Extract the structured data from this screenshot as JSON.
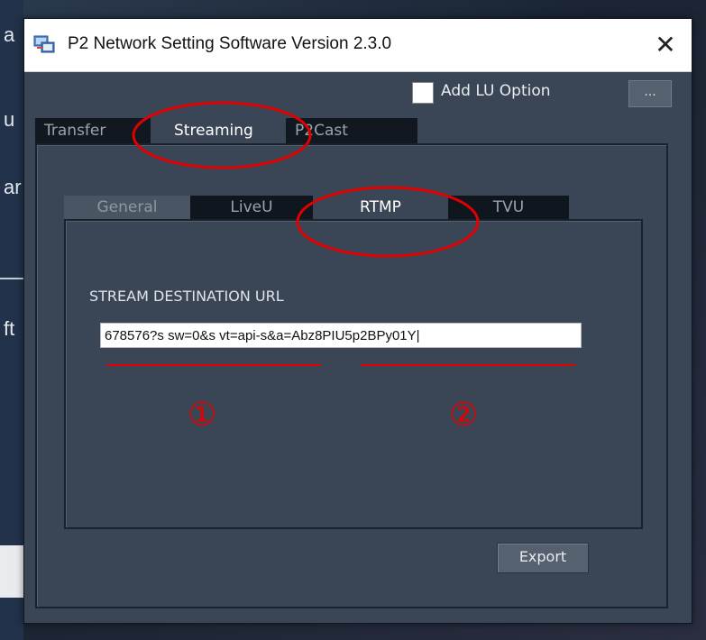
{
  "background": {
    "fragments": [
      "a",
      "u",
      "ar",
      "ft"
    ]
  },
  "window": {
    "title": "P2 Network Setting Software  Version 2.3.0",
    "close_glyph": "✕"
  },
  "options": {
    "add_lu_label": "Add LU Option",
    "dots_label": "..."
  },
  "top_tabs": [
    {
      "label": "Transfer"
    },
    {
      "label": "Streaming"
    },
    {
      "label": "P2Cast"
    }
  ],
  "inner_tabs": [
    {
      "label": "General"
    },
    {
      "label": "LiveU"
    },
    {
      "label": "RTMP"
    },
    {
      "label": "TVU"
    }
  ],
  "rtmp": {
    "url_label": "STREAM DESTINATION URL",
    "url_value": "678576?s sw=0&s vt=api-s&a=Abz8PIU5p2BPy01Y|"
  },
  "export_label": "Export",
  "annotations": {
    "marker_1": "①",
    "marker_2": "②",
    "color": "#e00000"
  }
}
